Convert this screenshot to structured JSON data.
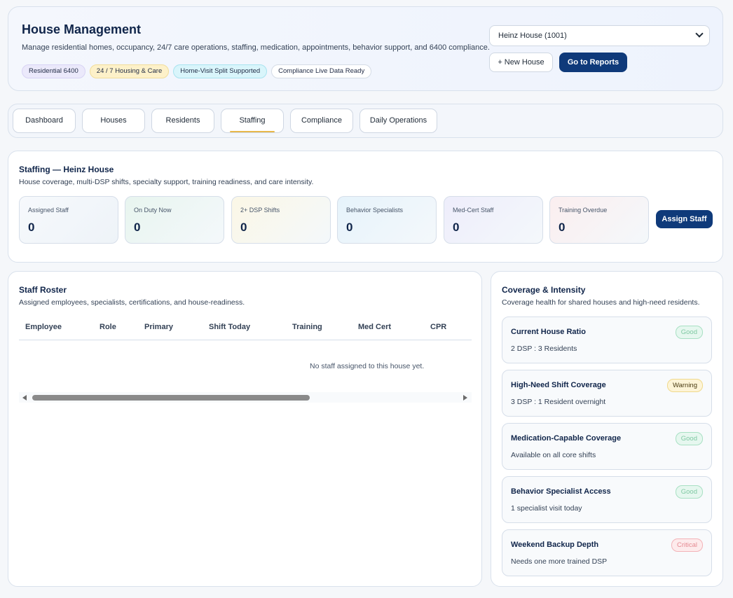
{
  "header": {
    "title": "House Management",
    "subtitle": "Manage residential homes, occupancy, 24/7 care operations, staffing, medication, appointments, behavior support, and 6400 compliance.",
    "badges": [
      "Residential 6400",
      "24 / 7 Housing & Care",
      "Home-Visit Split Supported",
      "Compliance Live Data Ready"
    ],
    "house_select": "Heinz House (1001)",
    "new_house_label": "+ New House",
    "go_reports_label": "Go to Reports"
  },
  "tabs": [
    {
      "label": "Dashboard"
    },
    {
      "label": "Houses"
    },
    {
      "label": "Residents"
    },
    {
      "label": "Staffing",
      "active": true
    },
    {
      "label": "Compliance"
    },
    {
      "label": "Daily Operations"
    }
  ],
  "staffing": {
    "title": "Staffing — Heinz House",
    "subtitle": "House coverage, multi-DSP shifts, specialty support, training readiness, and care intensity.",
    "stats": [
      {
        "label": "Assigned Staff",
        "value": "0"
      },
      {
        "label": "On Duty Now",
        "value": "0"
      },
      {
        "label": "2+ DSP Shifts",
        "value": "0"
      },
      {
        "label": "Behavior Specialists",
        "value": "0"
      },
      {
        "label": "Med-Cert Staff",
        "value": "0"
      },
      {
        "label": "Training Overdue",
        "value": "0"
      }
    ],
    "assign_label": "Assign Staff"
  },
  "roster": {
    "title": "Staff Roster",
    "subtitle": "Assigned employees, specialists, certifications, and house-readiness.",
    "columns": [
      "Employee",
      "Role",
      "Primary",
      "Shift Today",
      "Training",
      "Med Cert",
      "CPR"
    ],
    "empty_message": "No staff assigned to this house yet."
  },
  "coverage": {
    "title": "Coverage & Intensity",
    "subtitle": "Coverage health for shared houses and high-need residents.",
    "items": [
      {
        "title": "Current House Ratio",
        "detail": "2 DSP : 3 Residents",
        "status": "Good"
      },
      {
        "title": "High-Need Shift Coverage",
        "detail": "3 DSP : 1 Resident overnight",
        "status": "Warning"
      },
      {
        "title": "Medication-Capable Coverage",
        "detail": "Available on all core shifts",
        "status": "Good"
      },
      {
        "title": "Behavior Specialist Access",
        "detail": "1 specialist visit today",
        "status": "Good"
      },
      {
        "title": "Weekend Backup Depth",
        "detail": "Needs one more trained DSP",
        "status": "Critical"
      }
    ]
  },
  "colors": {
    "primary": "#0f3a7a",
    "tab_active_underline": "#e8b84a",
    "good": "#7fc9a3",
    "warning": "#f0d98b",
    "critical": "#e58a92"
  }
}
